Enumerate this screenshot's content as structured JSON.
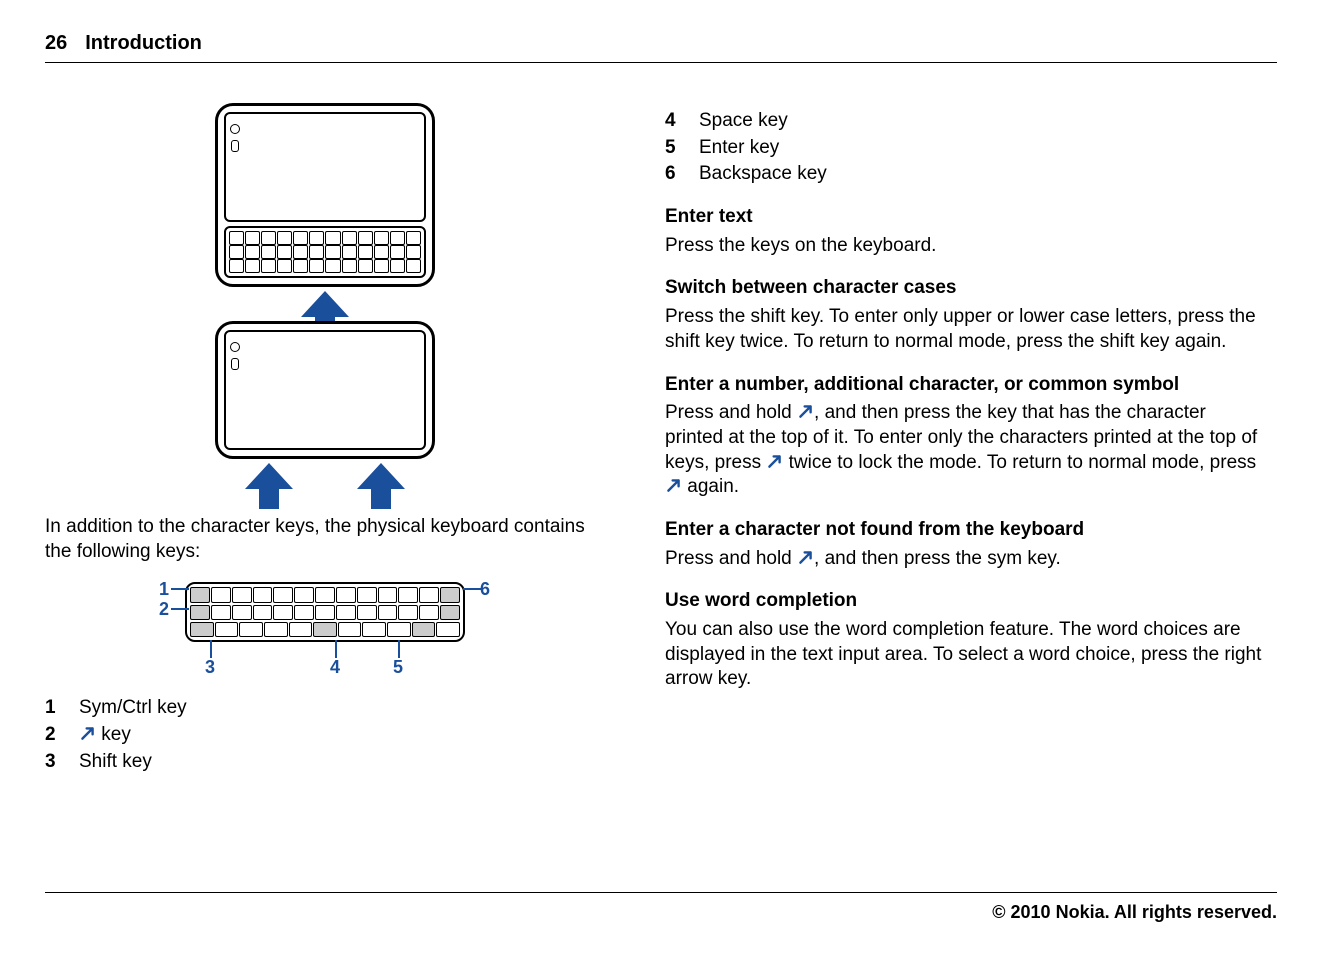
{
  "header": {
    "page_number": "26",
    "section": "Introduction"
  },
  "left": {
    "intro_para": "In addition to the character keys, the physical keyboard contains the following keys:",
    "diagram_labels": {
      "l1": "1",
      "l2": "2",
      "l3": "3",
      "l4": "4",
      "l5": "5",
      "l6": "6"
    },
    "legend": [
      {
        "num": "1",
        "text": "Sym/Ctrl key"
      },
      {
        "num": "2",
        "text": "key",
        "with_sym_icon": true
      },
      {
        "num": "3",
        "text": "Shift key"
      }
    ]
  },
  "right": {
    "legend": [
      {
        "num": "4",
        "text": "Space key"
      },
      {
        "num": "5",
        "text": "Enter key"
      },
      {
        "num": "6",
        "text": "Backspace key"
      }
    ],
    "sections": [
      {
        "heading": "Enter text",
        "body_plain": "Press the keys on the keyboard."
      },
      {
        "heading": "Switch between character cases",
        "body_plain": "Press the shift key. To enter only upper or lower case letters, press the shift key twice. To return to normal mode, press the shift key again."
      },
      {
        "heading": "Enter a number, additional character, or common symbol",
        "body_parts": [
          "Press and hold ",
          {
            "icon": true
          },
          ", and then press the key that has the character printed at the top of it. To enter only the characters printed at the top of keys, press ",
          {
            "icon": true
          },
          " twice to lock the mode. To return to normal mode, press ",
          {
            "icon": true
          },
          " again."
        ]
      },
      {
        "heading": "Enter a character not found from the keyboard",
        "body_parts": [
          "Press and hold ",
          {
            "icon": true
          },
          ", and then press the sym key."
        ]
      },
      {
        "heading": "Use word completion",
        "body_plain": "You can also use the word completion feature. The word choices are displayed in the text input area. To select a word choice, press the right arrow key."
      }
    ]
  },
  "footer": "© 2010 Nokia. All rights reserved."
}
